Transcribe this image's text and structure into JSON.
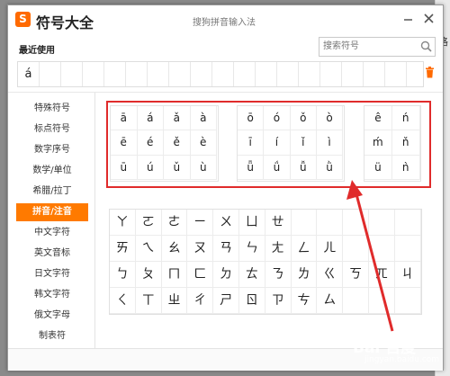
{
  "window": {
    "app_title": "符号大全",
    "subtitle": "搜狗拼音输入法"
  },
  "background": {
    "side_label": "格"
  },
  "recent": {
    "label": "最近使用",
    "symbols": [
      "á",
      "",
      "",
      "",
      "",
      "",
      "",
      "",
      "",
      "",
      "",
      "",
      "",
      "",
      "",
      "",
      "",
      ""
    ]
  },
  "search": {
    "placeholder": "搜索符号"
  },
  "sidebar": {
    "items": [
      {
        "label": "特殊符号"
      },
      {
        "label": "标点符号"
      },
      {
        "label": "数字序号"
      },
      {
        "label": "数学/单位"
      },
      {
        "label": "希腊/拉丁"
      },
      {
        "label": "拼音/注音",
        "active": true
      },
      {
        "label": "中文字符"
      },
      {
        "label": "英文音标"
      },
      {
        "label": "日文字符"
      },
      {
        "label": "韩文字符"
      },
      {
        "label": "俄文字母"
      },
      {
        "label": "制表符"
      }
    ]
  },
  "pinyin": {
    "group_a": [
      "ā",
      "á",
      "ǎ",
      "à",
      "ē",
      "é",
      "ě",
      "è",
      "ū",
      "ú",
      "ǔ",
      "ù"
    ],
    "group_o": [
      "ō",
      "ó",
      "ǒ",
      "ò",
      "ī",
      "í",
      "ǐ",
      "ì",
      "ǖ",
      "ǘ",
      "ǚ",
      "ǜ"
    ],
    "group_e": [
      "ê",
      "ń",
      "ḿ",
      "ň",
      "ü",
      "ǹ"
    ]
  },
  "zhuyin": [
    "ㄚ",
    "ㄛ",
    "ㄜ",
    "ㄧ",
    "ㄨ",
    "ㄩ",
    "ㄝ",
    "",
    "",
    "",
    "",
    "",
    "ㄞ",
    "ㄟ",
    "ㄠ",
    "ㄡ",
    "ㄢ",
    "ㄣ",
    "ㄤ",
    "ㄥ",
    "ㄦ",
    "",
    "",
    "",
    "ㄅ",
    "ㄆ",
    "ㄇ",
    "ㄈ",
    "ㄉ",
    "ㄊ",
    "ㄋ",
    "ㄌ",
    "ㄍ",
    "ㄎ",
    "ㄫ",
    "ㄐ",
    "ㄑ",
    "ㄒ",
    "ㄓ",
    "ㄔ",
    "ㄕ",
    "ㄖ",
    "ㄗ",
    "ㄘ",
    "ㄙ",
    "",
    "",
    ""
  ],
  "watermark": {
    "text": "Bai 百度",
    "sub": "jingyan.baidu.com"
  },
  "colors": {
    "accent": "#ff7a00",
    "highlight": "#e02b2b"
  }
}
